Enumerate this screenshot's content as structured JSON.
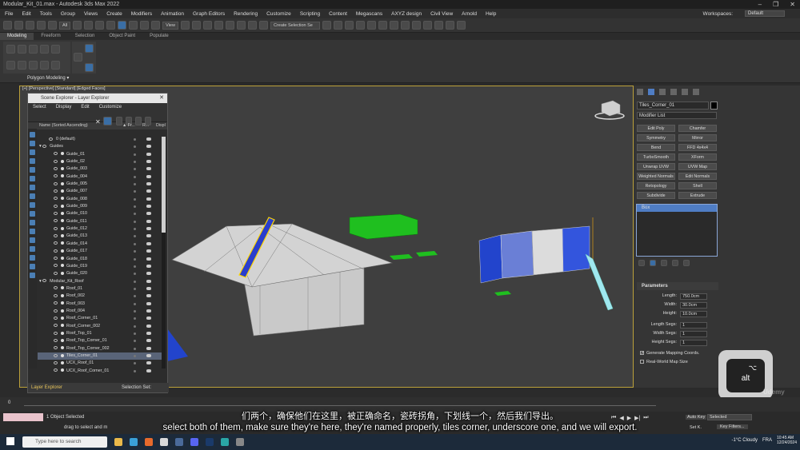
{
  "window": {
    "title": "Modular_Kit_01.max - Autodesk 3ds Max 2022",
    "controls": [
      "–",
      "❐",
      "✕"
    ]
  },
  "menu": {
    "items": [
      "File",
      "Edit",
      "Tools",
      "Group",
      "Views",
      "Create",
      "Modifiers",
      "Animation",
      "Graph Editors",
      "Rendering",
      "Customize",
      "Scripting",
      "Content",
      "Megascans",
      "AXYZ design",
      "Civil View",
      "Arnold",
      "Help"
    ],
    "workspaces_label": "Workspaces:",
    "workspaces_value": "Default"
  },
  "toolbar": {
    "filter_value": "All",
    "view_value": "View",
    "selection_set_placeholder": "Create Selection Se"
  },
  "ribbon": {
    "tabs": [
      "Modeling",
      "Freeform",
      "Selection",
      "Object Paint",
      "Populate"
    ],
    "active_tab": "Modeling",
    "panel_label": "Polygon Modeling ▾"
  },
  "viewport": {
    "label": "[+] [Perspective] [Standard] [Edged Faces]"
  },
  "scene_explorer": {
    "title": "Scene Explorer - Layer Explorer",
    "menu": [
      "Select",
      "Display",
      "Edit",
      "Customize"
    ],
    "columns": {
      "name": "Name (Sorted Ascending)",
      "c2": "▲ Fr...",
      "c3": "R...",
      "c4": "Displ"
    },
    "rows": [
      {
        "name": "0 (default)",
        "indent": 1,
        "selected": false
      },
      {
        "name": "Guides",
        "indent": 0,
        "selected": false
      },
      {
        "name": "Guide_01",
        "indent": 2,
        "selected": false
      },
      {
        "name": "Guide_02",
        "indent": 2,
        "selected": false
      },
      {
        "name": "Guide_003",
        "indent": 2,
        "selected": false
      },
      {
        "name": "Guide_004",
        "indent": 2,
        "selected": false
      },
      {
        "name": "Guide_005",
        "indent": 2,
        "selected": false
      },
      {
        "name": "Guide_007",
        "indent": 2,
        "selected": false
      },
      {
        "name": "Guide_008",
        "indent": 2,
        "selected": false
      },
      {
        "name": "Guide_009",
        "indent": 2,
        "selected": false
      },
      {
        "name": "Guide_010",
        "indent": 2,
        "selected": false
      },
      {
        "name": "Guide_011",
        "indent": 2,
        "selected": false
      },
      {
        "name": "Guide_012",
        "indent": 2,
        "selected": false
      },
      {
        "name": "Guide_013",
        "indent": 2,
        "selected": false
      },
      {
        "name": "Guide_014",
        "indent": 2,
        "selected": false
      },
      {
        "name": "Guide_017",
        "indent": 2,
        "selected": false
      },
      {
        "name": "Guide_018",
        "indent": 2,
        "selected": false
      },
      {
        "name": "Guide_019",
        "indent": 2,
        "selected": false
      },
      {
        "name": "Guide_020",
        "indent": 2,
        "selected": false
      },
      {
        "name": "Modular_Kit_Roof",
        "indent": 0,
        "selected": false
      },
      {
        "name": "Roof_01",
        "indent": 2,
        "selected": false
      },
      {
        "name": "Roof_002",
        "indent": 2,
        "selected": false
      },
      {
        "name": "Roof_003",
        "indent": 2,
        "selected": false
      },
      {
        "name": "Roof_004",
        "indent": 2,
        "selected": false
      },
      {
        "name": "Roof_Corner_01",
        "indent": 2,
        "selected": false
      },
      {
        "name": "Roof_Corner_002",
        "indent": 2,
        "selected": false
      },
      {
        "name": "Roof_Top_01",
        "indent": 2,
        "selected": false
      },
      {
        "name": "Roof_Top_Corner_01",
        "indent": 2,
        "selected": false
      },
      {
        "name": "Roof_Top_Corner_002",
        "indent": 2,
        "selected": false
      },
      {
        "name": "Tiles_Corner_01",
        "indent": 2,
        "selected": true
      },
      {
        "name": "UCX_Roof_01",
        "indent": 2,
        "selected": false
      },
      {
        "name": "UCX_Roof_Corner_01",
        "indent": 2,
        "selected": false
      }
    ],
    "footer_left": "Layer Explorer",
    "footer_right": "Selection Set:"
  },
  "command_panel": {
    "object_name": "Tiles_Corner_01",
    "modifier_list": "Modifier List",
    "modifiers": [
      "Edit Poly",
      "Chamfer",
      "Symmetry",
      "Mirror",
      "Bend",
      "FFD 4x4x4",
      "TurboSmooth",
      "XForm",
      "Unwrap UVW",
      "UVW Map",
      "Weighted Normals",
      "Edit Normals",
      "Retopology",
      "Shell",
      "Subdivide",
      "Extrude"
    ],
    "stack": [
      "Box"
    ],
    "parameters_title": "Parameters",
    "params": [
      {
        "label": "Length:",
        "value": "750.0cm"
      },
      {
        "label": "Width:",
        "value": "30.0cm"
      },
      {
        "label": "Height:",
        "value": "10.0cm"
      },
      {
        "label": "Length Segs:",
        "value": "1"
      },
      {
        "label": "Width Segs:",
        "value": "1"
      },
      {
        "label": "Height Segs:",
        "value": "1"
      }
    ],
    "checks": [
      {
        "label": "Generate Mapping Coords.",
        "checked": true
      },
      {
        "label": "Real-World Map Size",
        "checked": false
      }
    ]
  },
  "alt_key": {
    "symbol": "⌥",
    "label": "alt"
  },
  "status": {
    "selection": "1 Object Selected",
    "prompt": "drag to select and m",
    "auto_key": "Auto Key",
    "selected_dropdown": "Selected",
    "set_key": "Set K.",
    "key_filters": "Key Filters...",
    "frame": "0"
  },
  "subtitles": {
    "zh": "们两个，确保他们在这里，被正确命名，瓷砖拐角，下划线一个，然后我们导出。",
    "en": "select both of them, make sure they're here, they're named properly, tiles corner, underscore one, and we will export."
  },
  "taskbar": {
    "search_placeholder": "Type here to search",
    "weather": "-1°C  Cloudy",
    "language": "FRA",
    "time": "10:45 AM",
    "date": "12/24/2024"
  },
  "watermark": "Udemy",
  "colors": {
    "accent_blue": "#4f7dc4",
    "viewport_border": "#bca13a",
    "green_box": "#1fbf1f",
    "blue_panel": "#2244cc"
  }
}
